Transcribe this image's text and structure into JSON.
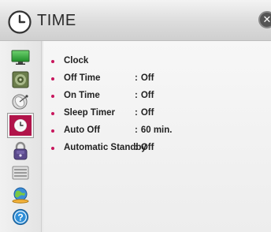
{
  "header": {
    "title": "TIME",
    "icon": "clock-icon",
    "close_label": "✕"
  },
  "sidebar": {
    "items": [
      {
        "name": "picture",
        "icon": "monitor-icon"
      },
      {
        "name": "audio",
        "icon": "speaker-icon"
      },
      {
        "name": "channel",
        "icon": "satellite-dish-icon"
      },
      {
        "name": "time",
        "icon": "clock-icon",
        "active": true
      },
      {
        "name": "lock",
        "icon": "padlock-icon"
      },
      {
        "name": "option",
        "icon": "options-icon"
      },
      {
        "name": "network",
        "icon": "globe-network-icon"
      },
      {
        "name": "support",
        "icon": "help-icon"
      }
    ]
  },
  "menu": {
    "items": [
      {
        "label": "Clock",
        "value": ""
      },
      {
        "label": "Off Time",
        "value": "Off"
      },
      {
        "label": "On Time",
        "value": "Off"
      },
      {
        "label": "Sleep Timer",
        "value": "Off"
      },
      {
        "label": "Auto Off",
        "value": "60 min."
      },
      {
        "label": "Automatic Standby",
        "value": "Off"
      }
    ]
  },
  "colors": {
    "accent": "#c8175d",
    "active_tab": "#b1144a"
  }
}
